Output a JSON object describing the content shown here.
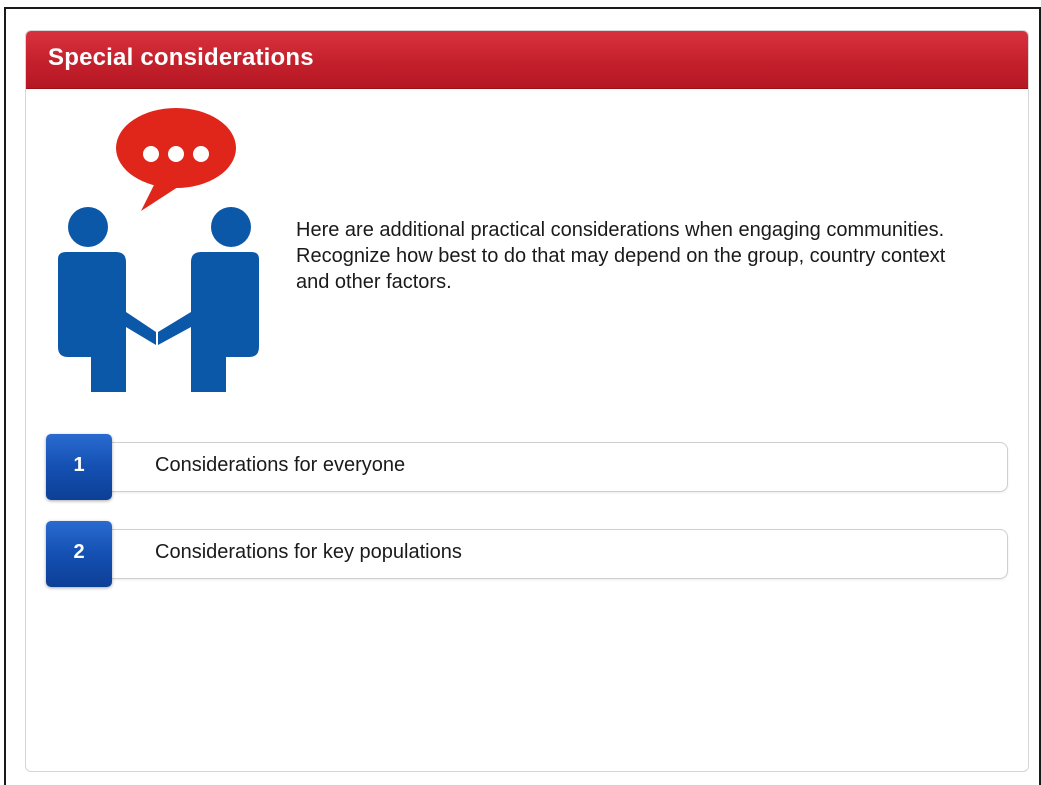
{
  "header": {
    "title": "Special considerations"
  },
  "intro": {
    "text": "Here are additional practical considerations when engaging communities. Recognize how best to do that may depend on the group, country context and other factors."
  },
  "illustration": {
    "icon": "handshake-conversation-icon",
    "speech_bubble_color": "#e0251b",
    "people_color": "#0b57a8"
  },
  "items": [
    {
      "number": "1",
      "label": "Considerations for everyone"
    },
    {
      "number": "2",
      "label": "Considerations for key populations"
    }
  ],
  "colors": {
    "header": "#c4202c",
    "badge": "#1450b2"
  }
}
